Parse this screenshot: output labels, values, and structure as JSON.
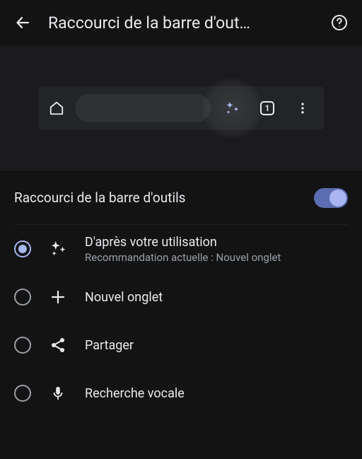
{
  "header": {
    "title": "Raccourci de la barre d'out…"
  },
  "preview": {
    "tab_count": "1"
  },
  "toggle": {
    "label": "Raccourci de la barre d'outils"
  },
  "options": {
    "based_on_usage": {
      "title": "D'après votre utilisation",
      "subtitle": "Recommandation actuelle :  Nouvel onglet"
    },
    "new_tab": {
      "title": "Nouvel onglet"
    },
    "share": {
      "title": "Partager"
    },
    "voice": {
      "title": "Recherche vocale"
    }
  }
}
